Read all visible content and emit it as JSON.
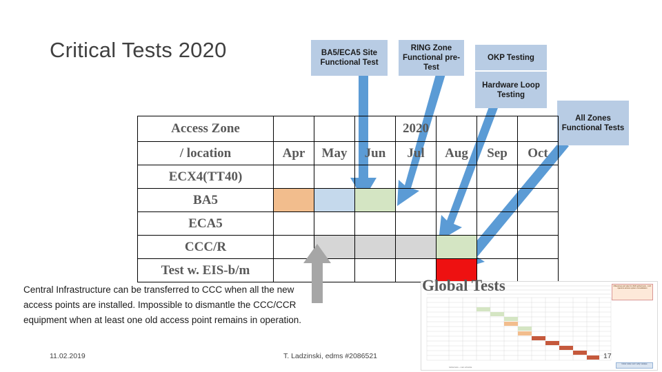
{
  "slide": {
    "title": "Critical Tests 2020",
    "body_text": "Central Infrastructure can be transferred to CCC when all the new access points are installed. Impossible to dismantle the CCC/CCR equipment when at least one old access point remains in operation.",
    "footer": {
      "date": "11.02.2019",
      "author": "T. Ladzinski, edms #2086521",
      "page": "17"
    }
  },
  "callouts": [
    {
      "id": "ba5",
      "label": "BA5/ECA5 Site Functional Test"
    },
    {
      "id": "ring",
      "label": "RING Zone Functional pre-Test"
    },
    {
      "id": "okp",
      "label": "OKP Testing"
    },
    {
      "id": "hw",
      "label": "Hardware Loop Testing"
    },
    {
      "id": "all",
      "label": "All Zones Functional Tests"
    }
  ],
  "table": {
    "header_label_line1": "Access Zone",
    "header_label_line2": "/ location",
    "year": "2020",
    "months": [
      "Apr",
      "May",
      "Jun",
      "Jul",
      "Aug",
      "Sep",
      "Oct"
    ],
    "rows": [
      {
        "label": "ECX4(TT40)",
        "cells": [
          "",
          "",
          "",
          "",
          "",
          "",
          ""
        ]
      },
      {
        "label": "BA5",
        "cells": [
          "orange",
          "blue",
          "green",
          "",
          "",
          "",
          ""
        ]
      },
      {
        "label": "ECA5",
        "cells": [
          "",
          "",
          "",
          "",
          "",
          "",
          ""
        ]
      },
      {
        "label": "CCC/R",
        "cells": [
          "",
          "gray",
          "gray",
          "gray",
          "green",
          "",
          ""
        ]
      },
      {
        "label": "Test w. EIS-b/m",
        "cells": [
          "",
          "",
          "",
          "",
          "red",
          "",
          ""
        ]
      }
    ]
  },
  "thumbnail": {
    "title": "Global Tests",
    "side_title": "Milestones and plan for 2020 global tests - LHC injectors access system consolidation",
    "side_note": "Colour codes: test / verify / analyse",
    "footer_note": "Global tests – main schedule"
  },
  "colors": {
    "callout_bg": "#b8cce4",
    "arrow_blue": "#5b9bd5",
    "arrow_gray": "#a6a6a6",
    "fill_orange": "#f2bd8d",
    "fill_blue": "#c5d9ec",
    "fill_green": "#d4e5c3",
    "fill_gray": "#d6d6d6",
    "fill_red": "#ee1111",
    "text_gray": "#595959"
  }
}
